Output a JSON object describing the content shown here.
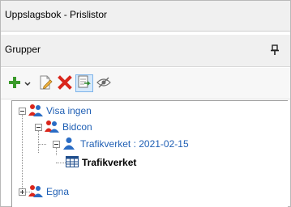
{
  "window": {
    "title": "Uppslagsbok - Prislistor"
  },
  "panel": {
    "title": "Grupper"
  },
  "toolbar": {
    "buttons": [
      {
        "icon": "plus-icon",
        "color": "#3a9a2a"
      },
      {
        "icon": "dropdown-arrow-icon"
      },
      {
        "icon": "edit-document-icon"
      },
      {
        "icon": "delete-x-icon",
        "color": "#d9261c"
      },
      {
        "icon": "copy-document-icon",
        "state": "active"
      },
      {
        "icon": "eye-hidden-icon"
      }
    ]
  },
  "tree": {
    "nodes": [
      {
        "label": "Visa ingen",
        "icon": "group-users-icon",
        "expanded": true
      },
      {
        "label": "Bidcon",
        "icon": "group-users-icon",
        "expanded": true
      },
      {
        "label": "Trafikverket : 2021-02-15",
        "icon": "user-icon",
        "expanded": true
      },
      {
        "label": "Trafikverket",
        "icon": "table-icon",
        "selected": true
      },
      {
        "label": "Egna",
        "icon": "group-users-icon",
        "expanded": false
      }
    ]
  }
}
